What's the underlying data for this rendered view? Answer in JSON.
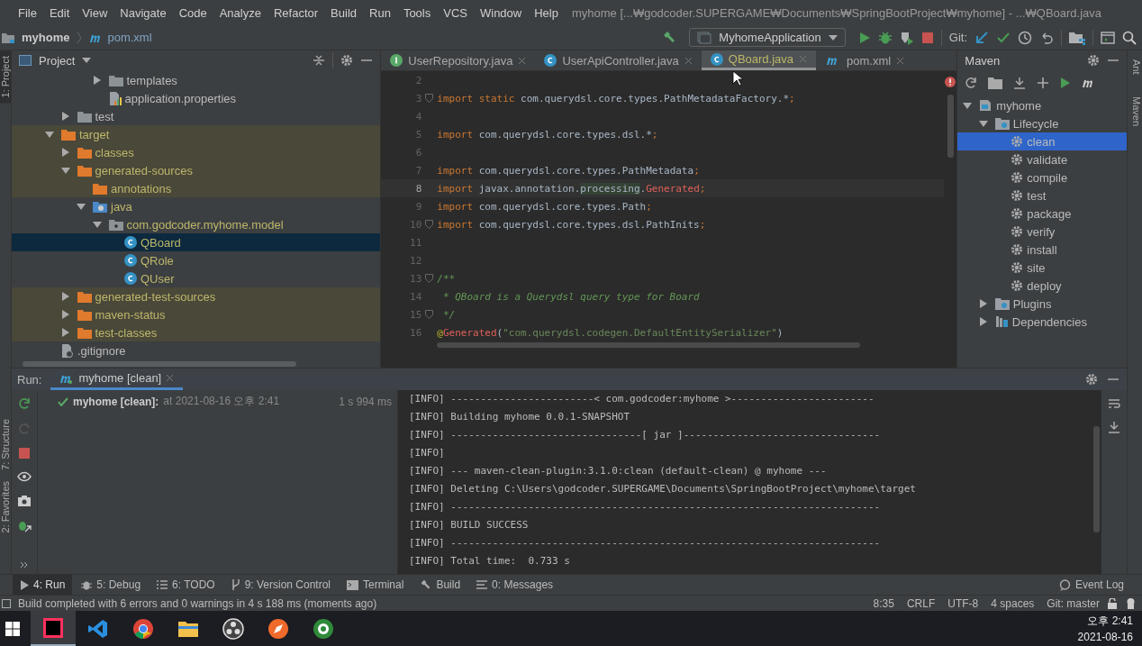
{
  "window": {
    "title": "myhome [...₩godcoder.SUPERGAME₩Documents₩SpringBootProject₩myhome] - ...₩QBoard.java"
  },
  "menu": [
    "File",
    "Edit",
    "View",
    "Navigate",
    "Code",
    "Analyze",
    "Refactor",
    "Build",
    "Run",
    "Tools",
    "VCS",
    "Window",
    "Help"
  ],
  "breadcrumb": [
    {
      "label": "myhome",
      "kind": "folder"
    },
    {
      "label": "pom.xml",
      "kind": "maven"
    }
  ],
  "toolbar": {
    "run_config": "MyhomeApplication",
    "git_label": "Git:"
  },
  "left_stripe": {
    "top": [
      {
        "label": "1: Project",
        "selected": true
      }
    ],
    "bottom": [
      {
        "label": "7: Structure",
        "selected": false
      },
      {
        "label": "2: Favorites",
        "selected": false
      }
    ]
  },
  "project": {
    "title": "Project",
    "tree": [
      {
        "children": [
          {
            "children": [
              {
                "children": [
                  {
                    "label": "templates",
                    "kind": "folder",
                    "expanded": false,
                    "excluded": false,
                    "generated": false,
                    "selected": false
                  },
                  {
                    "label": "application.properties",
                    "kind": "properties",
                    "excluded": false,
                    "generated": false,
                    "selected": false
                  }
                ]
              }
            ]
          },
          {
            "label": "test",
            "kind": "folder",
            "expanded": false,
            "excluded": false,
            "generated": false,
            "selected": false
          }
        ]
      },
      {
        "label": "target",
        "kind": "folder",
        "expanded": true,
        "excluded": true,
        "generated": true,
        "selected": false,
        "children": [
          {
            "label": "classes",
            "kind": "folder",
            "expanded": false,
            "excluded": true,
            "generated": true,
            "selected": false
          },
          {
            "label": "generated-sources",
            "kind": "folder",
            "expanded": true,
            "excluded": true,
            "generated": true,
            "selected": false,
            "children": [
              {
                "label": "annotations",
                "kind": "folder",
                "excluded": true,
                "generated": true,
                "selected": false
              },
              {
                "label": "java",
                "kind": "source-root",
                "expanded": true,
                "excluded": false,
                "generated": true,
                "selected": false,
                "children": [
                  {
                    "label": "com.godcoder.myhome.model",
                    "kind": "package",
                    "expanded": true,
                    "excluded": false,
                    "generated": true,
                    "selected": false,
                    "children": [
                      {
                        "label": "QBoard",
                        "kind": "class",
                        "excluded": false,
                        "generated": true,
                        "selected": true
                      },
                      {
                        "label": "QRole",
                        "kind": "class",
                        "excluded": false,
                        "generated": true,
                        "selected": false
                      },
                      {
                        "label": "QUser",
                        "kind": "class",
                        "excluded": false,
                        "generated": true,
                        "selected": false
                      }
                    ]
                  }
                ]
              }
            ]
          },
          {
            "label": "generated-test-sources",
            "kind": "folder",
            "expanded": false,
            "excluded": true,
            "generated": true,
            "selected": false
          },
          {
            "label": "maven-status",
            "kind": "folder",
            "expanded": false,
            "excluded": true,
            "generated": true,
            "selected": false
          },
          {
            "label": "test-classes",
            "kind": "folder",
            "expanded": false,
            "excluded": true,
            "generated": true,
            "selected": false
          }
        ]
      },
      {
        "label": ".gitignore",
        "kind": "gitignore",
        "excluded": false,
        "generated": false,
        "selected": false
      }
    ]
  },
  "editor": {
    "tabs": [
      {
        "label": "UserRepository.java",
        "kind": "interface",
        "selected": false,
        "generated": false
      },
      {
        "label": "UserApiController.java",
        "kind": "class",
        "selected": false,
        "generated": false
      },
      {
        "label": "QBoard.java",
        "kind": "class",
        "selected": true,
        "generated": true
      },
      {
        "label": "pom.xml",
        "kind": "maven",
        "selected": false,
        "generated": false
      }
    ],
    "lines": [
      {
        "n": "2",
        "fold": false,
        "current": false
      },
      {
        "n": "3",
        "fold": true,
        "current": false,
        "tokens": [
          {
            "t": "import static ",
            "kind": "kw"
          },
          {
            "t": "com.querydsl.core.types.PathMetadataFactory.*",
            "kind": "plain"
          },
          {
            "t": ";",
            "kind": "kw"
          }
        ]
      },
      {
        "n": "4",
        "fold": false,
        "current": false
      },
      {
        "n": "5",
        "fold": false,
        "current": false,
        "tokens": [
          {
            "t": "import ",
            "kind": "kw"
          },
          {
            "t": "com.querydsl.core.types.dsl.*",
            "kind": "plain"
          },
          {
            "t": ";",
            "kind": "kw"
          }
        ]
      },
      {
        "n": "6",
        "fold": false,
        "current": false
      },
      {
        "n": "7",
        "fold": false,
        "current": false,
        "tokens": [
          {
            "t": "import ",
            "kind": "kw"
          },
          {
            "t": "com.querydsl.core.types.PathMetadata",
            "kind": "plain"
          },
          {
            "t": ";",
            "kind": "kw"
          }
        ]
      },
      {
        "n": "8",
        "fold": false,
        "current": true,
        "tokens": [
          {
            "t": "import ",
            "kind": "kw"
          },
          {
            "t": "javax.annotation.",
            "kind": "plain"
          },
          {
            "t": "processing",
            "kind": "hl"
          },
          {
            "t": ".",
            "kind": "plain"
          },
          {
            "t": "Generated",
            "kind": "err"
          },
          {
            "t": ";",
            "kind": "kw"
          }
        ]
      },
      {
        "n": "9",
        "fold": false,
        "current": false,
        "tokens": [
          {
            "t": "import ",
            "kind": "kw"
          },
          {
            "t": "com.querydsl.core.types.Path",
            "kind": "plain"
          },
          {
            "t": ";",
            "kind": "kw"
          }
        ]
      },
      {
        "n": "10",
        "fold": true,
        "current": false,
        "tokens": [
          {
            "t": "import ",
            "kind": "kw"
          },
          {
            "t": "com.querydsl.core.types.dsl.PathInits",
            "kind": "plain"
          },
          {
            "t": ";",
            "kind": "kw"
          }
        ]
      },
      {
        "n": "11",
        "fold": false,
        "current": false
      },
      {
        "n": "12",
        "fold": false,
        "current": false
      },
      {
        "n": "13",
        "fold": true,
        "current": false,
        "tokens": [
          {
            "t": "/**",
            "kind": "doc"
          }
        ]
      },
      {
        "n": "14",
        "fold": false,
        "current": false,
        "tokens": [
          {
            "t": " * QBoard is a Querydsl query type for Board",
            "kind": "doc"
          }
        ]
      },
      {
        "n": "15",
        "fold": true,
        "current": false,
        "tokens": [
          {
            "t": " */",
            "kind": "doc"
          }
        ]
      },
      {
        "n": "16",
        "fold": false,
        "current": false,
        "tokens": [
          {
            "t": "@",
            "kind": "ann"
          },
          {
            "t": "Generated",
            "kind": "err"
          },
          {
            "t": "(",
            "kind": "plain"
          },
          {
            "t": "\"com.querydsl.codegen.DefaultEntitySerializer\"",
            "kind": "str"
          },
          {
            "t": ")",
            "kind": "plain"
          }
        ]
      }
    ]
  },
  "maven": {
    "title": "Maven",
    "tree": [
      {
        "label": "myhome",
        "kind": "maven-project",
        "expanded": true,
        "selected": false,
        "children": [
          {
            "label": "Lifecycle",
            "kind": "lifecycle",
            "expanded": true,
            "selected": false,
            "children": [
              {
                "label": "clean",
                "kind": "goal",
                "selected": true
              },
              {
                "label": "validate",
                "kind": "goal",
                "selected": false
              },
              {
                "label": "compile",
                "kind": "goal",
                "selected": false
              },
              {
                "label": "test",
                "kind": "goal",
                "selected": false
              },
              {
                "label": "package",
                "kind": "goal",
                "selected": false
              },
              {
                "label": "verify",
                "kind": "goal",
                "selected": false
              },
              {
                "label": "install",
                "kind": "goal",
                "selected": false
              },
              {
                "label": "site",
                "kind": "goal",
                "selected": false
              },
              {
                "label": "deploy",
                "kind": "goal",
                "selected": false
              }
            ]
          },
          {
            "label": "Plugins",
            "kind": "lifecycle",
            "expanded": false,
            "selected": false
          },
          {
            "label": "Dependencies",
            "kind": "dependencies",
            "expanded": false,
            "selected": false
          }
        ]
      }
    ]
  },
  "right_stripe": [
    "Ant",
    "Maven"
  ],
  "run": {
    "label": "Run:",
    "tab": "myhome [clean]",
    "entry": {
      "name": "myhome [clean]:",
      "when": "at 2021-08-16 오후 2:41",
      "duration": "1 s 994 ms"
    },
    "console": [
      "[INFO] ------------------------< com.godcoder:myhome >------------------------",
      "[INFO] Building myhome 0.0.1-SNAPSHOT",
      "[INFO] --------------------------------[ jar ]---------------------------------",
      "[INFO]",
      "[INFO] --- maven-clean-plugin:3.1.0:clean (default-clean) @ myhome ---",
      "[INFO] Deleting C:\\Users\\godcoder.SUPERGAME\\Documents\\SpringBootProject\\myhome\\target",
      "[INFO] ------------------------------------------------------------------------",
      "[INFO] BUILD SUCCESS",
      "[INFO] ------------------------------------------------------------------------",
      "[INFO] Total time:  0.733 s"
    ]
  },
  "tool_tabs": [
    {
      "label": "4: Run",
      "kind": "run",
      "selected": true
    },
    {
      "label": "5: Debug",
      "kind": "debug",
      "selected": false
    },
    {
      "label": "6: TODO",
      "kind": "todo",
      "selected": false
    },
    {
      "label": "9: Version Control",
      "kind": "vcs",
      "selected": false
    },
    {
      "label": "Terminal",
      "kind": "terminal",
      "selected": false
    },
    {
      "label": "Build",
      "kind": "build",
      "selected": false
    },
    {
      "label": "0: Messages",
      "kind": "messages",
      "selected": false
    }
  ],
  "event_log": "Event Log",
  "status_bar": {
    "message": "Build completed with 6 errors and 0 warnings in 4 s 188 ms (moments ago)",
    "items": [
      "8:35",
      "CRLF",
      "UTF-8",
      "4 spaces",
      "Git: master"
    ]
  },
  "taskbar": {
    "apps": [
      {
        "kind": "intellij",
        "selected": true
      },
      {
        "kind": "vscode",
        "selected": false
      },
      {
        "kind": "chrome",
        "selected": false
      },
      {
        "kind": "explorer",
        "selected": false
      },
      {
        "kind": "obs",
        "selected": false
      },
      {
        "kind": "compass",
        "selected": false
      },
      {
        "kind": "hs",
        "selected": false
      }
    ],
    "time": "오후 2:41",
    "date": "2021-08-16"
  }
}
